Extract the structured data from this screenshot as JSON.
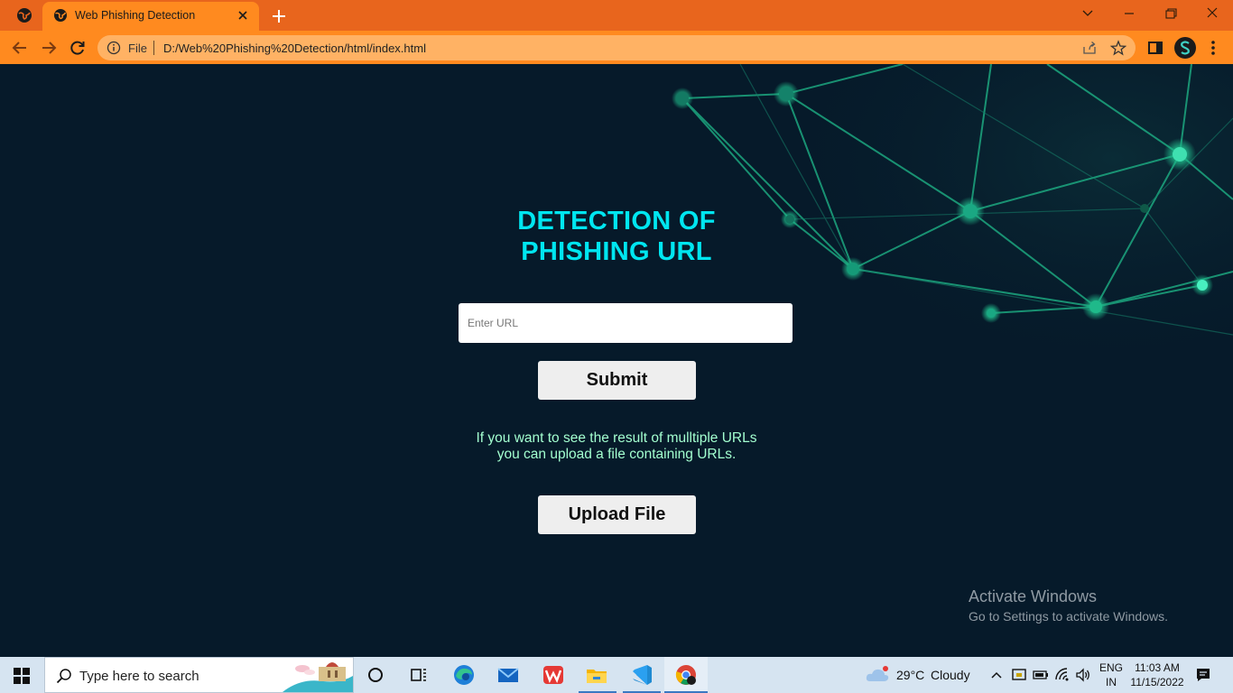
{
  "browser": {
    "tab_title": "Web Phishing Detection",
    "address_scheme": "File",
    "address_url": "D:/Web%20Phishing%20Detection/html/index.html",
    "profile_initial": "S"
  },
  "page": {
    "heading_line1": "DETECTION OF",
    "heading_line2": "PHISHING URL",
    "url_placeholder": "Enter URL",
    "submit_label": "Submit",
    "info_line1": "If you want to see the result of mulltiple URLs",
    "info_line2": "you can upload a file containing URLs.",
    "upload_label": "Upload File"
  },
  "watermark": {
    "title": "Activate Windows",
    "subtitle": "Go to Settings to activate Windows."
  },
  "taskbar": {
    "search_placeholder": "Type here to search",
    "weather_temp": "29°C",
    "weather_text": "Cloudy",
    "lang_line1": "ENG",
    "lang_line2": "IN",
    "time": "11:03 AM",
    "date": "11/15/2022"
  },
  "colors": {
    "tab_strip": "#e8651d",
    "toolbar": "#ff8a1f",
    "page_background": "#061a2a",
    "heading": "#00e6f0",
    "info_text": "#a3ffd0",
    "network_lines": "#1fb98a"
  },
  "icons": [
    "globe-icon",
    "close-icon",
    "plus-icon",
    "chevron-down-icon",
    "minimize-icon",
    "restore-icon",
    "back-arrow-icon",
    "forward-arrow-icon",
    "reload-icon",
    "info-icon",
    "share-icon",
    "star-icon",
    "sidebar-icon",
    "kebab-menu-icon",
    "windows-start-icon",
    "search-icon",
    "cortana-icon",
    "task-view-icon",
    "edge-icon",
    "mail-icon",
    "wps-icon",
    "file-explorer-icon",
    "vscode-icon",
    "chrome-icon",
    "cloud-icon",
    "chevron-up-icon",
    "battery-icon",
    "wifi-icon",
    "speaker-icon",
    "notification-icon"
  ]
}
